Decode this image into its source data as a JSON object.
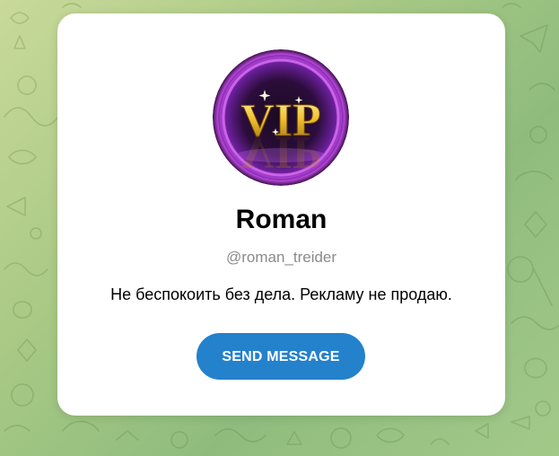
{
  "profile": {
    "name": "Roman",
    "username": "@roman_treider",
    "bio": "Не беспокоить без дела. Рекламу не продаю.",
    "avatar_text": "VIP",
    "send_button_label": "SEND MESSAGE"
  },
  "colors": {
    "accent": "#2481cc",
    "card_background": "#ffffff",
    "username_gray": "#8a8a8a",
    "background_green": "#a9c985"
  },
  "icons": {
    "background": "telegram-doodle-pattern",
    "avatar": "vip-gold-emblem"
  }
}
